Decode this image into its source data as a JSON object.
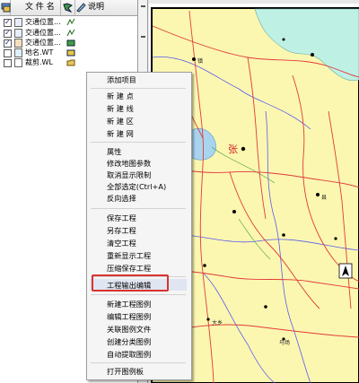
{
  "layer_panel": {
    "header": {
      "col_name": "文 件 名",
      "col_desc": "说明"
    },
    "layers": [
      {
        "checked": true,
        "name": "交通位置...",
        "type": "line-file"
      },
      {
        "checked": true,
        "name": "交通位置...",
        "type": "line-file"
      },
      {
        "checked": true,
        "name": "交通位置...",
        "type": "area-file"
      },
      {
        "checked": false,
        "name": "地名.WT",
        "type": "point-file"
      },
      {
        "checked": false,
        "name": "裁剪.WL",
        "type": "line-file"
      }
    ]
  },
  "context_menu": {
    "groups": [
      [
        "添加项目"
      ],
      [
        "新 建 点",
        "新 建 线",
        "新 建 区",
        "新 建 网"
      ],
      [
        "属性",
        "修改地图参数",
        "取消显示限制",
        "全部选定(Ctrl+A)",
        "反向选择"
      ],
      [
        "保存工程",
        "另存工程",
        "清空工程",
        "重新显示工程",
        "压缩保存工程"
      ],
      [
        "工程输出编辑"
      ],
      [
        "新建工程图例",
        "编辑工程图例",
        "关联图例文件",
        "创建分类图例",
        "自动提取图例"
      ],
      [
        "打开图例板"
      ]
    ],
    "highlighted_item": "工程输出编辑"
  },
  "map": {
    "place_labels": [
      "张",
      "大乡",
      "马场",
      "县",
      "镇"
    ],
    "colors": {
      "land": "#fbf7b0",
      "sea": "#bff0e4",
      "lake": "#a9d4ee",
      "road": "#e23a3a",
      "boundary": "#5a5af0"
    }
  }
}
